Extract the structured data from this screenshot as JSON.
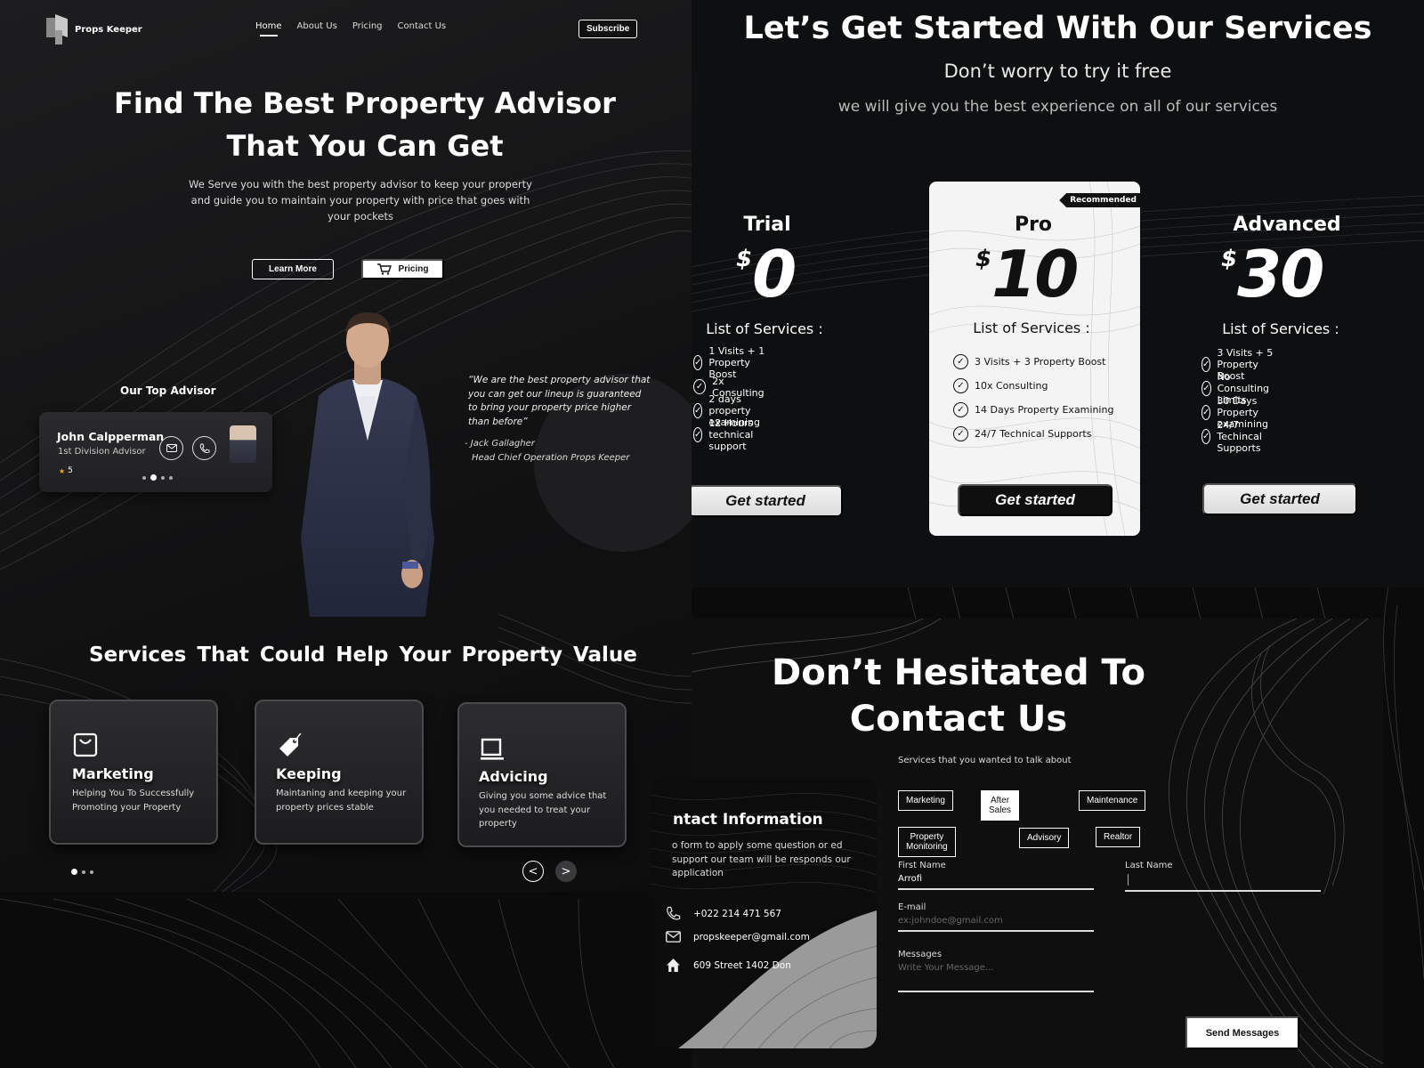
{
  "brand": {
    "name": "Props Keeper"
  },
  "nav": {
    "items": [
      "Home",
      "About Us",
      "Pricing",
      "Contact Us"
    ],
    "subscribe": "Subscribe"
  },
  "hero": {
    "title_line1": "Find The Best Property Advisor",
    "title_line2": "That You Can Get",
    "subtitle": "We Serve you with the best property advisor to keep your property and guide you to maintain your property with price that goes with your pockets",
    "learn_more": "Learn More",
    "pricing": "Pricing"
  },
  "advisor": {
    "section_label": "Our Top Advisor",
    "name": "John Calpperman",
    "role": "1st Division Advisor",
    "rating": "5",
    "carousel_active": 2,
    "carousel_count": 4
  },
  "quote": {
    "text": "“We are the best property advisor that you can get our lineup is guaranteed to bring your property price higher than before”",
    "author": "- Jack Gallagher",
    "author_role": "Head Chief Operation Props Keeper"
  },
  "services": {
    "title": "Services  That  Could Help Your Property Value",
    "cards": [
      {
        "icon": "shopping-bag-icon",
        "title": "Marketing",
        "desc": "Helping You To Successfully Promoting your Property"
      },
      {
        "icon": "price-tag-icon",
        "title": "Keeping",
        "desc": "Maintaning and keeping your property prices stable"
      },
      {
        "icon": "laptop-icon",
        "title": "Advicing",
        "desc": "Giving you some advice that you needed to treat your property"
      }
    ],
    "prev": "<",
    "next": ">"
  },
  "pricing": {
    "title": "Let’s Get Started With Our Services",
    "subtitle1": "Don’t worry to try it free",
    "subtitle2": "we will give you the best experience on all of our services",
    "currency": "$",
    "list_title": "List of Services :",
    "plans": [
      {
        "name": "Trial",
        "price": "0",
        "features": [
          "1 Visits + 1 Property Boost",
          "2x Consulting",
          "2 days property examining",
          "12 Hours technical support"
        ],
        "cta": "Get started"
      },
      {
        "name": "Pro",
        "price": "10",
        "ribbon": "Recommended",
        "features": [
          "3 Visits + 3 Property Boost",
          "10x Consulting",
          "14 Days Property Examining",
          "24/7 Technical Supports"
        ],
        "cta": "Get started"
      },
      {
        "name": "Advanced",
        "price": "30",
        "features": [
          "3 Visits + 5 Property Boost",
          "No Consulting Limits",
          "30 Days Property examining",
          "24/7 Techincal Supports"
        ],
        "cta": "Get started"
      }
    ]
  },
  "contact": {
    "title_line1": "Don’t Hesitated To",
    "title_line2": "Contact Us",
    "services_question": "Services that you wanted to talk about",
    "chips": [
      "Marketing",
      "After Sales",
      "Maintenance",
      "Property Monitoring",
      "Advisory",
      "Realtor"
    ],
    "selected_chip": "After Sales",
    "first_name_label": "First Name",
    "first_name_value": "Arrofi",
    "last_name_label": "Last Name",
    "email_label": "E-mail",
    "email_placeholder": "ex:johndoe@gmail.com",
    "messages_label": "Messages",
    "messages_placeholder": "Write Your Message...",
    "send": "Send Messages",
    "info": {
      "title": "ntact Information",
      "text": "o form to apply some question or ed support our team will be responds our application",
      "phone": "+022 214 471 567",
      "email": "propskeeper@gmail.com",
      "address": "609 Street 1402 Don"
    }
  }
}
